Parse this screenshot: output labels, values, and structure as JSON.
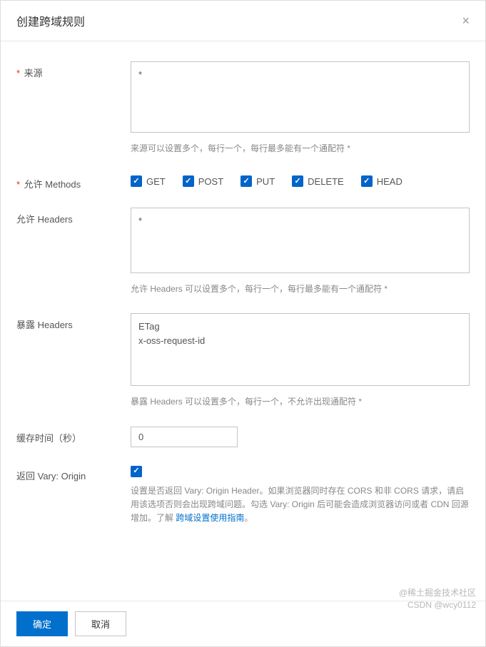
{
  "dialog": {
    "title": "创建跨域规则",
    "close": "×"
  },
  "form": {
    "source": {
      "label": "来源",
      "value": "*",
      "hint": "来源可以设置多个，每行一个，每行最多能有一个通配符 *"
    },
    "methods": {
      "label": "允许 Methods",
      "options": {
        "get": "GET",
        "post": "POST",
        "put": "PUT",
        "delete": "DELETE",
        "head": "HEAD"
      }
    },
    "allowHeaders": {
      "label": "允许 Headers",
      "value": "*",
      "hint": "允许 Headers 可以设置多个，每行一个，每行最多能有一个通配符 *"
    },
    "exposeHeaders": {
      "label": "暴露 Headers",
      "value": "ETag\nx-oss-request-id",
      "hint": "暴露 Headers 可以设置多个，每行一个，不允许出现通配符 *"
    },
    "cacheTime": {
      "label": "缓存时间（秒）",
      "value": "0"
    },
    "varyOrigin": {
      "label": "返回 Vary: Origin",
      "hint_pre": "设置是否返回 Vary: Origin Header。如果浏览器同时存在 CORS 和非 CORS 请求，请启用该选项否则会出现跨域问题。勾选 Vary: Origin 后可能会造成浏览器访问或者 CDN 回源增加。了解 ",
      "hint_link": "跨域设置使用指南",
      "hint_post": "。"
    }
  },
  "footer": {
    "ok": "确定",
    "cancel": "取消"
  },
  "watermark": {
    "line1": "@稀土掘金技术社区",
    "line2": "CSDN @wcy0112"
  }
}
